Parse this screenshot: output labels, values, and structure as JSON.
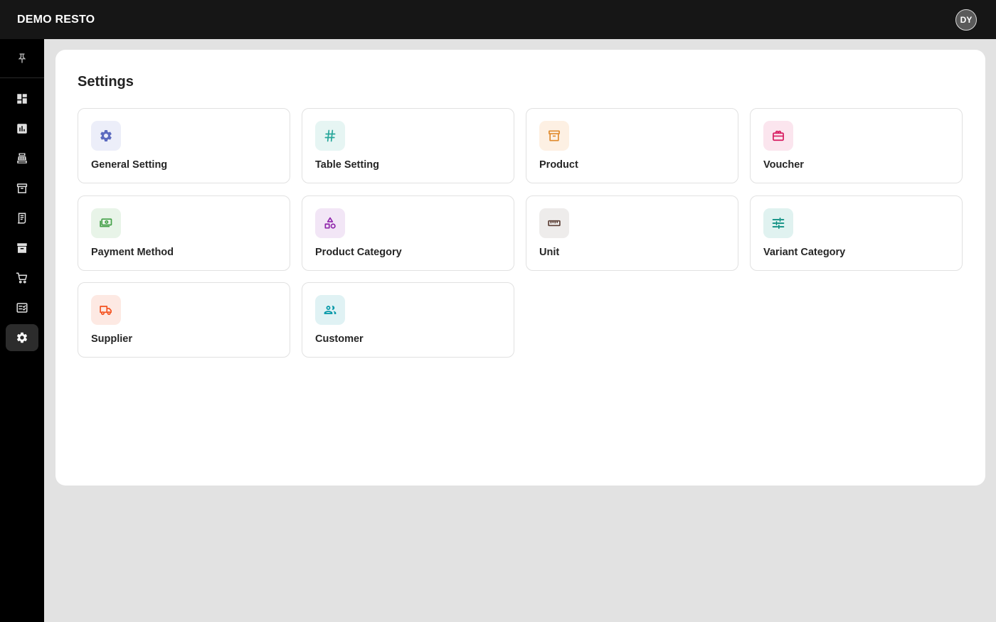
{
  "header": {
    "app_title": "DEMO RESTO",
    "avatar_initials": "DY"
  },
  "sidebar": {
    "pin_icon": "pin-icon",
    "items": [
      {
        "icon": "dashboard-icon",
        "active": false
      },
      {
        "icon": "report-chart-icon",
        "active": false
      },
      {
        "icon": "cash-register-icon",
        "active": false
      },
      {
        "icon": "archive-box-icon",
        "active": false
      },
      {
        "icon": "receipt-icon",
        "active": false
      },
      {
        "icon": "inventory-box-icon",
        "active": false
      },
      {
        "icon": "cart-icon",
        "active": false
      },
      {
        "icon": "checklist-icon",
        "active": false
      },
      {
        "icon": "gear-icon",
        "active": true
      }
    ]
  },
  "main": {
    "title": "Settings",
    "cards": [
      {
        "label": "General Setting",
        "icon": "gear-icon",
        "color": "#5c6bc0",
        "bg": "#eceef9"
      },
      {
        "label": "Table Setting",
        "icon": "hash-icon",
        "color": "#26a69a",
        "bg": "#e6f5f3"
      },
      {
        "label": "Product",
        "icon": "archive-icon",
        "color": "#e08a2c",
        "bg": "#fdf0e3"
      },
      {
        "label": "Voucher",
        "icon": "ticket-icon",
        "color": "#d81b60",
        "bg": "#fbe5ee"
      },
      {
        "label": "Payment Method",
        "icon": "cash-icon",
        "color": "#43a047",
        "bg": "#e8f4e8"
      },
      {
        "label": "Product Category",
        "icon": "shapes-icon",
        "color": "#8e24aa",
        "bg": "#f2e6f6"
      },
      {
        "label": "Unit",
        "icon": "ruler-icon",
        "color": "#5d4037",
        "bg": "#eeeceb"
      },
      {
        "label": "Variant Category",
        "icon": "sliders-icon",
        "color": "#00897b",
        "bg": "#e0f2f0"
      },
      {
        "label": "Supplier",
        "icon": "truck-icon",
        "color": "#f4511e",
        "bg": "#fde9e3"
      },
      {
        "label": "Customer",
        "icon": "users-icon",
        "color": "#0097a7",
        "bg": "#e0f2f4"
      }
    ]
  }
}
